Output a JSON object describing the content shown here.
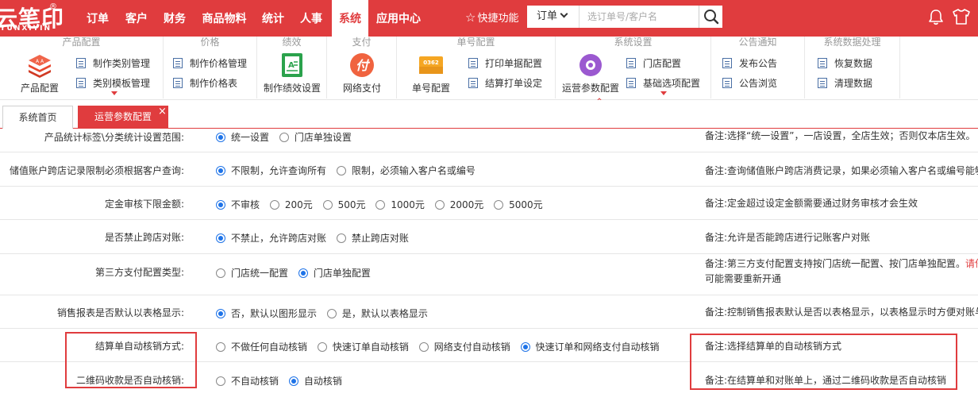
{
  "logo": {
    "text": "云笔印",
    "sub": "YUNXIYIN",
    "reg": "®"
  },
  "nav": [
    "订单",
    "客户",
    "财务",
    "商品物料",
    "统计",
    "人事",
    "系统",
    "应用中心"
  ],
  "nav_active": "系统",
  "quick_label": "快捷功能",
  "search": {
    "type": "订单",
    "placeholder": "选订单号/客户名"
  },
  "ribbon": {
    "product": {
      "title": "产品配置",
      "big": "产品配置",
      "items": [
        "制作类别管理",
        "类别模板管理"
      ]
    },
    "price": {
      "title": "价格",
      "items": [
        "制作价格管理",
        "制作价格表"
      ]
    },
    "perf": {
      "title": "绩效",
      "big": "制作绩效设置"
    },
    "pay": {
      "title": "支付",
      "big": "网络支付",
      "icon_text": "付"
    },
    "number": {
      "title": "单号配置",
      "big": "单号配置",
      "icon_text": "0362",
      "items": [
        "打印单据配置",
        "结算打单设定"
      ]
    },
    "system": {
      "title": "系统设置",
      "big": "运营参数配置",
      "items": [
        "门店配置",
        "基础选项配置"
      ]
    },
    "notice": {
      "title": "公告通知",
      "items": [
        "发布公告",
        "公告浏览"
      ]
    },
    "data": {
      "title": "系统数据处理",
      "items": [
        "恢复数据",
        "清理数据"
      ]
    }
  },
  "tabs": {
    "home": "系统首页",
    "ops": "运营参数配置",
    "close": "×"
  },
  "settings": [
    {
      "label": "产品统计标签\\分类统计设置范围:",
      "options": [
        "统一设置",
        "门店单独设置"
      ],
      "selected": 0,
      "note": "备注:选择“统一设置”，一店设置，全店生效；否则仅本店生效。"
    },
    {
      "label": "储值账户跨店记录限制必须根据客户查询:",
      "options": [
        "不限制，允许查询所有",
        "限制，必须输入客户名或编号"
      ],
      "selected": 0,
      "note": "备注:查询储值账户跨店消费记录，如果必须输入客户名或编号能够"
    },
    {
      "label": "定金审核下限金额:",
      "options": [
        "不审核",
        "200元",
        "500元",
        "1000元",
        "2000元",
        "5000元"
      ],
      "selected": 0,
      "note": "备注:定金超过设定金额需要通过财务审核才会生效"
    },
    {
      "label": "是否禁止跨店对账:",
      "options": [
        "不禁止，允许跨店对账",
        "禁止跨店对账"
      ],
      "selected": 0,
      "note": "备注:允许是否能跨店进行记账客户对账"
    },
    {
      "label": "第三方支付配置类型:",
      "options": [
        "门店统一配置",
        "门店单独配置"
      ],
      "selected": 1,
      "note": "备注:第三方支付配置支持按门店统一配置、按门店单独配置。",
      "note_red": "请仔",
      "note_line2": "可能需要重新开通"
    },
    {
      "label": "销售报表是否默认以表格显示:",
      "options": [
        "否，默认以图形显示",
        "是，默认以表格显示"
      ],
      "selected": 0,
      "note": "备注:控制销售报表默认是否以表格显示，以表格显示时方便对账与"
    },
    {
      "label": "结算单自动核销方式:",
      "options": [
        "不做任何自动核销",
        "快速订单自动核销",
        "网络支付自动核销",
        "快速订单和网络支付自动核销"
      ],
      "selected": 3,
      "note": "备注:选择结算单的自动核销方式"
    },
    {
      "label": "二维码收款是否自动核销:",
      "options": [
        "不自动核销",
        "自动核销"
      ],
      "selected": 1,
      "note": "备注:在结算单和对账单上，通过二维码收款是否自动核销"
    }
  ],
  "colors": {
    "brand_red": "#e03c3e",
    "radio_blue": "#1e73e8"
  }
}
